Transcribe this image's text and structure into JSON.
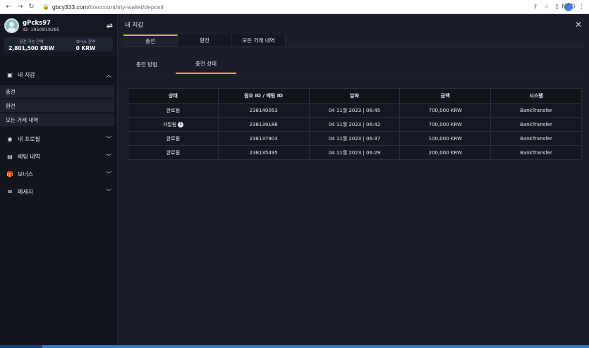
{
  "browser": {
    "url_host": "gbcy333.com",
    "url_path": "/#/account/my-wallet/deposit",
    "profile_label": "NEO"
  },
  "user": {
    "name": "gPcks97",
    "id_label": "ID: 1950819285"
  },
  "balances": [
    {
      "label": "환전 가능 잔액",
      "value": "2,801,500 KRW"
    },
    {
      "label": "보너스 잔액",
      "value": "0 KRW"
    }
  ],
  "sidebar": {
    "wallet_label": "내 지갑",
    "wallet_items": [
      "충전",
      "환전",
      "모든 거래 내역"
    ],
    "sections": [
      {
        "label": "내 프로필",
        "icon": "user-circle-icon"
      },
      {
        "label": "베팅 내역",
        "icon": "clipboard-icon"
      },
      {
        "label": "보너스",
        "icon": "gift-icon"
      },
      {
        "label": "메세지",
        "icon": "envelope-icon"
      }
    ]
  },
  "main": {
    "title": "내 지갑",
    "tabs": [
      "충전",
      "환전",
      "모든 거래 내역"
    ],
    "subtabs": [
      "충전 방법",
      "충전 상태"
    ]
  },
  "table": {
    "headers": [
      "상태",
      "참조 ID / 베팅 ID",
      "날짜",
      "금액",
      "시스템"
    ],
    "rows": [
      {
        "status": "완료됨",
        "info": false,
        "ref": "238140053",
        "date": "04 11월 2023 | 06:45",
        "amount": "700,000 KRW",
        "system": "BankTransfer"
      },
      {
        "status": "거절됨",
        "info": true,
        "ref": "238139188",
        "date": "04 11월 2023 | 06:42",
        "amount": "700,000 KRW",
        "system": "BankTransfer"
      },
      {
        "status": "완료됨",
        "info": false,
        "ref": "238137903",
        "date": "04 11월 2023 | 06:37",
        "amount": "100,000 KRW",
        "system": "BankTransfer"
      },
      {
        "status": "완료됨",
        "info": false,
        "ref": "238135495",
        "date": "04 11월 2023 | 06:29",
        "amount": "200,000 KRW",
        "system": "BankTransfer"
      }
    ]
  },
  "colors": {
    "accent": "#e3b04b",
    "sidebar_bg": "#12151d",
    "main_bg": "#1a1e2a"
  }
}
